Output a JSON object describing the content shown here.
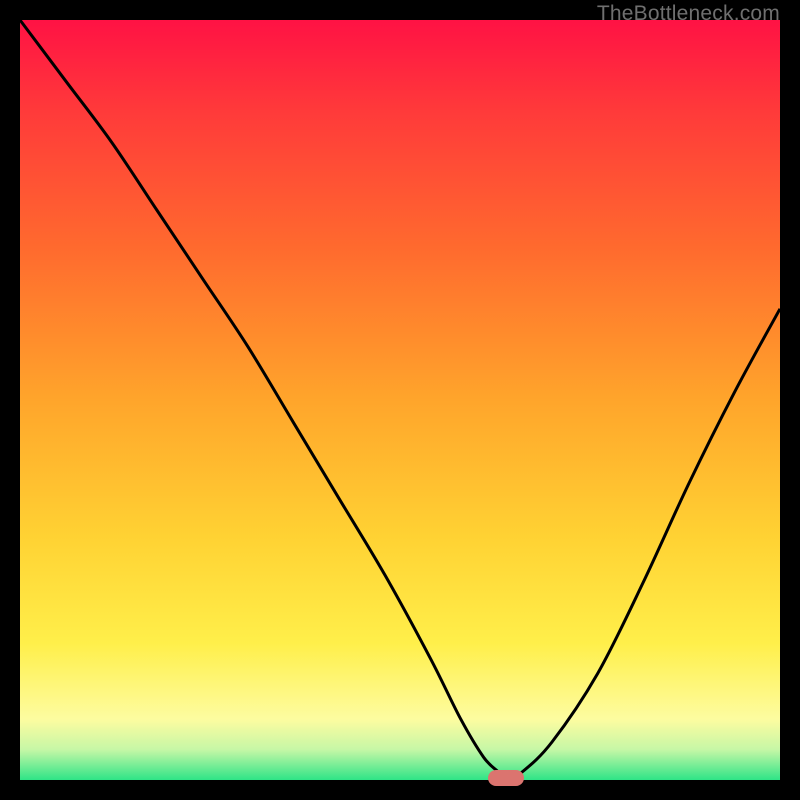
{
  "watermark": "TheBottleneck.com",
  "colors": {
    "frame": "#000000",
    "curve": "#000000",
    "marker": "#db746f",
    "gradient_stops": [
      "#ff1244",
      "#ff3a3a",
      "#ff6a2e",
      "#ffa52b",
      "#ffd233",
      "#ffef4a",
      "#fdfca0",
      "#c6f7a6",
      "#2fe487"
    ]
  },
  "chart_data": {
    "type": "line",
    "title": "",
    "xlabel": "",
    "ylabel": "",
    "xlim": [
      0,
      100
    ],
    "ylim": [
      0,
      100
    ],
    "x": [
      0,
      6,
      12,
      18,
      24,
      30,
      36,
      42,
      48,
      54,
      58,
      61,
      63,
      64,
      66,
      70,
      76,
      82,
      88,
      94,
      100
    ],
    "values": [
      100,
      92,
      84,
      75,
      66,
      57,
      47,
      37,
      27,
      16,
      8,
      3,
      1,
      0,
      1,
      5,
      14,
      26,
      39,
      51,
      62
    ],
    "marker": {
      "x": 64,
      "y": 0
    },
    "grid": false,
    "legend": false
  }
}
